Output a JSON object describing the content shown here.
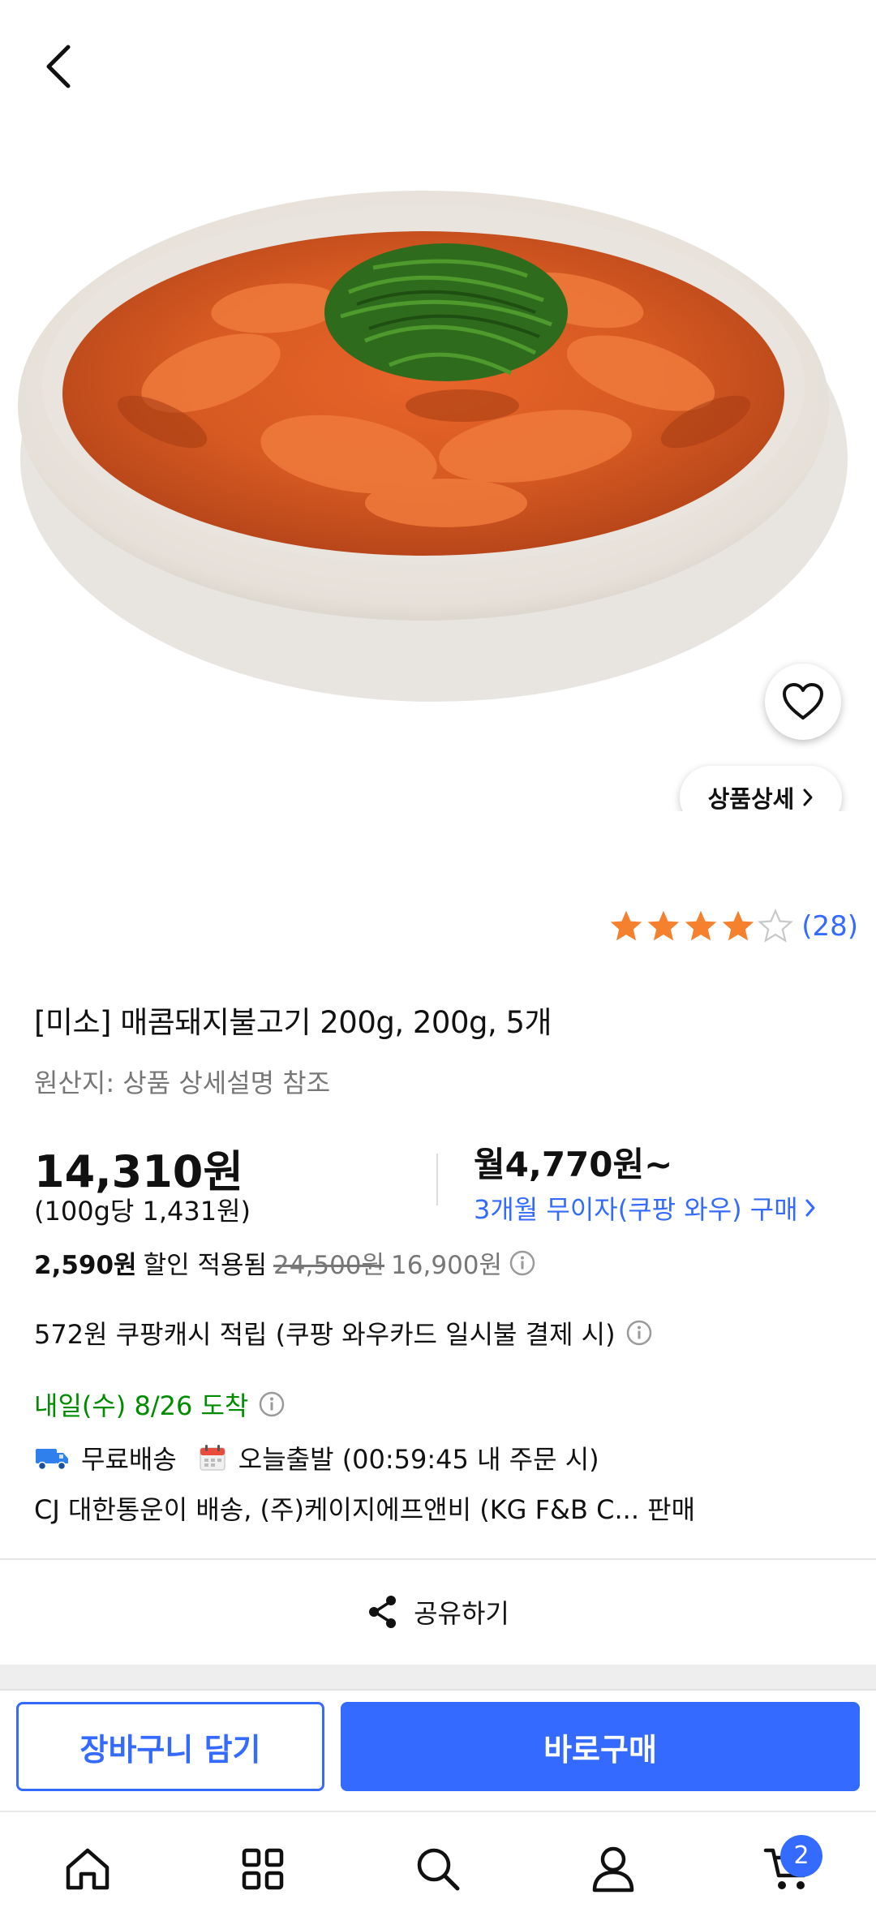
{
  "product": {
    "title": "[미소] 매콤돼지불고기 200g, 200g, 5개",
    "origin": "원산지: 상품 상세설명 참조",
    "detail_button": "상품상세",
    "image_icon": "spicy-pork-bulgogi-bowl",
    "image_count": 3,
    "current_image": 1
  },
  "rating": {
    "stars": 4,
    "max_stars": 5,
    "count": "(28)"
  },
  "pricing": {
    "price": "14,310원",
    "unit_price": "(100g당 1,431원)",
    "monthly": "월4,770원~",
    "monthly_link": "3개월 무이자(쿠팡 와우) 구매",
    "discount_amount": "2,590원",
    "discount_text": "할인 적용됨",
    "original_price": "24,500원",
    "coupon_price": "16,900원",
    "cash_reward": "572원 쿠팡캐시 적립 (쿠팡 와우카드 일시불 결제 시)"
  },
  "delivery": {
    "arrival": "내일(수) 8/26 도착",
    "free_shipping": "무료배송",
    "same_day": "오늘출발 (00:59:45 내 주문 시)",
    "seller": "CJ 대한통운이 배송, (주)케이지에프앤비 (KG F&B C... 판매"
  },
  "share": {
    "label": "공유하기"
  },
  "actions": {
    "add_to_cart": "장바구니 담기",
    "buy_now": "바로구매"
  },
  "nav": {
    "cart_count": "2"
  },
  "colors": {
    "accent": "#346aff",
    "arrival_green": "#008c00",
    "star": "#f5812f"
  }
}
